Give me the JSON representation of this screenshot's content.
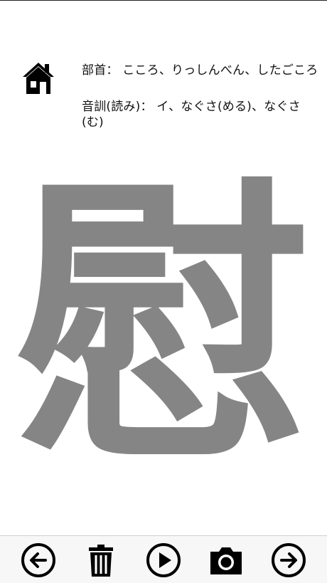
{
  "header": {
    "radical_label": "部首：",
    "radical_value": "こころ、りっしんべん、したごころ",
    "reading_label": "音訓(読み)：",
    "reading_value": "イ、なぐさ(める)、なぐさ(む)"
  },
  "main": {
    "kanji": "慰",
    "kanji_color": "#858585"
  },
  "icons": {
    "home": "home-icon",
    "prev": "arrow-left-circle-icon",
    "delete": "trash-icon",
    "play": "play-circle-icon",
    "camera": "camera-icon",
    "next": "arrow-right-circle-icon"
  }
}
